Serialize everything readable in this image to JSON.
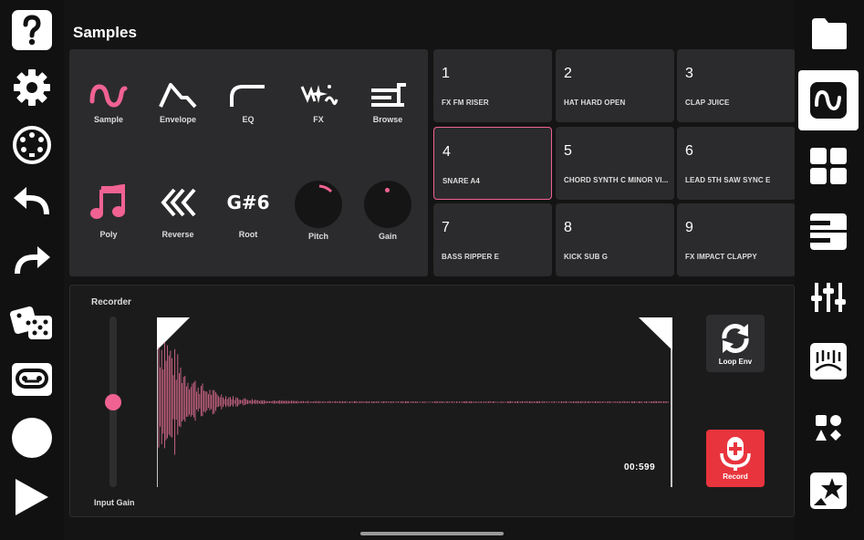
{
  "page_title": "Samples",
  "left_nav": {
    "icons": [
      "help-icon",
      "settings-gear-icon",
      "midi-icon",
      "undo-icon",
      "redo-icon",
      "dice-icon",
      "tape-icon",
      "record-circle-icon",
      "play-icon"
    ]
  },
  "tools": {
    "sample_label": "Sample",
    "envelope_label": "Envelope",
    "eq_label": "EQ",
    "fx_label": "FX",
    "browse_label": "Browse",
    "poly_label": "Poly",
    "reverse_label": "Reverse",
    "root_value": "G#6",
    "root_label": "Root",
    "pitch_label": "Pitch",
    "gain_label": "Gain"
  },
  "pads": [
    {
      "number": "1",
      "name": "FX FM RISER"
    },
    {
      "number": "2",
      "name": "HAT HARD OPEN"
    },
    {
      "number": "3",
      "name": "CLAP JUICE"
    },
    {
      "number": "4",
      "name": "SNARE A4"
    },
    {
      "number": "5",
      "name": "CHORD SYNTH C MINOR VI..."
    },
    {
      "number": "6",
      "name": "LEAD 5TH SAW SYNC E"
    },
    {
      "number": "7",
      "name": "BASS RIPPER E"
    },
    {
      "number": "8",
      "name": "KICK SUB G"
    },
    {
      "number": "9",
      "name": "FX IMPACT CLAPPY"
    }
  ],
  "selected_pad": "4",
  "recorder": {
    "label": "Recorder",
    "input_gain_label": "Input Gain",
    "input_gain_level": 0.5,
    "time": "00:599",
    "loop_env_label": "Loop Env",
    "record_label": "Record"
  },
  "right_nav": {
    "icons": [
      "folder-icon",
      "sample-wave-icon",
      "pads-grid-icon",
      "piano-keys-icon",
      "mixer-sliders-icon",
      "sampler-display-icon",
      "shapes-icon",
      "star-card-icon"
    ],
    "active": "sample-wave-icon"
  },
  "colors": {
    "accent": "#f06292",
    "record": "#e8343d",
    "panel": "#2b2b2d"
  }
}
